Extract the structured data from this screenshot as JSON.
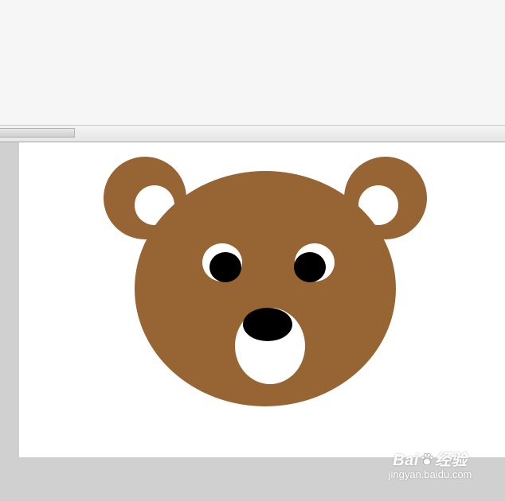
{
  "colors": {
    "bear_fur": "#976433",
    "bear_inner_ear": "#ffffff",
    "bear_eye_white": "#ffffff",
    "bear_pupil": "#000000",
    "bear_nose": "#000000",
    "bear_muzzle": "#ffffff",
    "canvas_bg": "#ffffff",
    "workspace_bg": "#d0d0d0",
    "top_panel_bg": "#f6f6f6"
  },
  "watermark": {
    "logo_left": "Bai",
    "logo_right": "经验",
    "url": "jingyan.baidu.com",
    "paw_icon": "paw-icon"
  }
}
